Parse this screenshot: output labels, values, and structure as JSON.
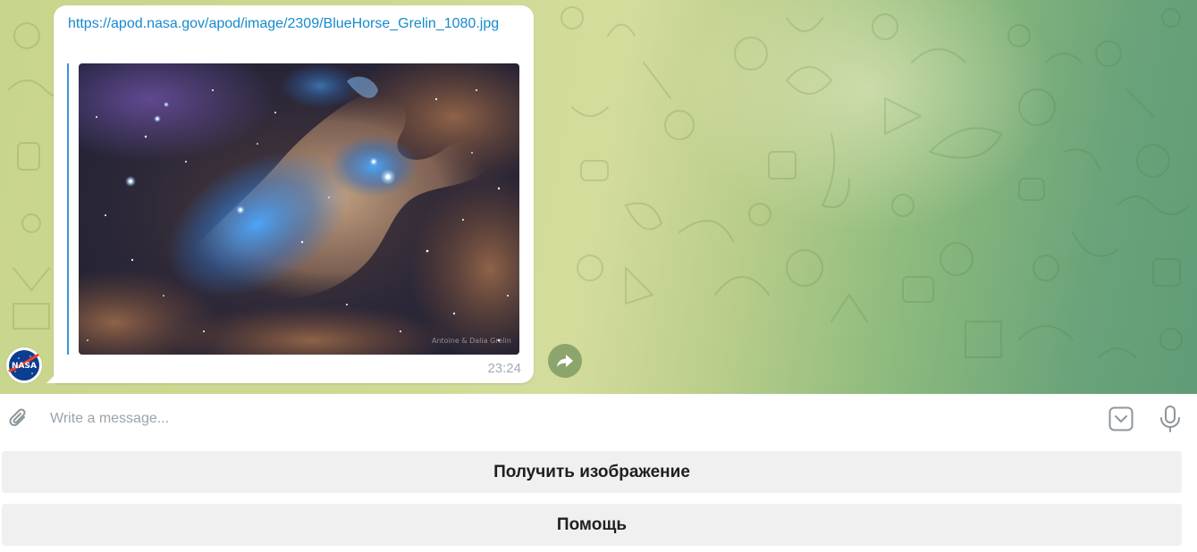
{
  "message": {
    "link_text": "https://apod.nasa.gov/apod/image/2309/BlueHorse_Grelin_1080.jpg",
    "time": "23:24",
    "image_credit_watermark": "Antoine & Dalia Grelin"
  },
  "composer": {
    "placeholder": "Write a message..."
  },
  "keyboard": {
    "buttons": [
      {
        "label": "Получить изображение"
      },
      {
        "label": "Помощь"
      }
    ]
  },
  "avatar": {
    "logo_text": "NASA"
  },
  "colors": {
    "link": "#168acd",
    "quote_bar": "#3a95d6",
    "time": "#a0acb6",
    "keyboard_button": "#f0f0f0"
  }
}
